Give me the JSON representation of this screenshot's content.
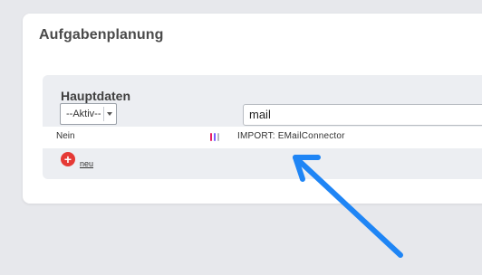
{
  "page": {
    "title": "Aufgabenplanung"
  },
  "section": {
    "title": "Hauptdaten"
  },
  "filter": {
    "selected": "--Aktiv--"
  },
  "search": {
    "value": "mail"
  },
  "table": {
    "rows": [
      {
        "active": "Nein",
        "priority_colors": [
          "#e91e63",
          "#7b61ff",
          "#b7b9c1"
        ],
        "task": "IMPORT: EMailConnector"
      }
    ]
  },
  "actions": {
    "add_label": "neu"
  },
  "icons": {
    "add": "plus-circle-icon",
    "dropdown": "chevron-down-icon",
    "annotation": "arrow-pointer"
  },
  "colors": {
    "accent_red": "#e53935",
    "annotation_blue": "#1f85f5"
  }
}
